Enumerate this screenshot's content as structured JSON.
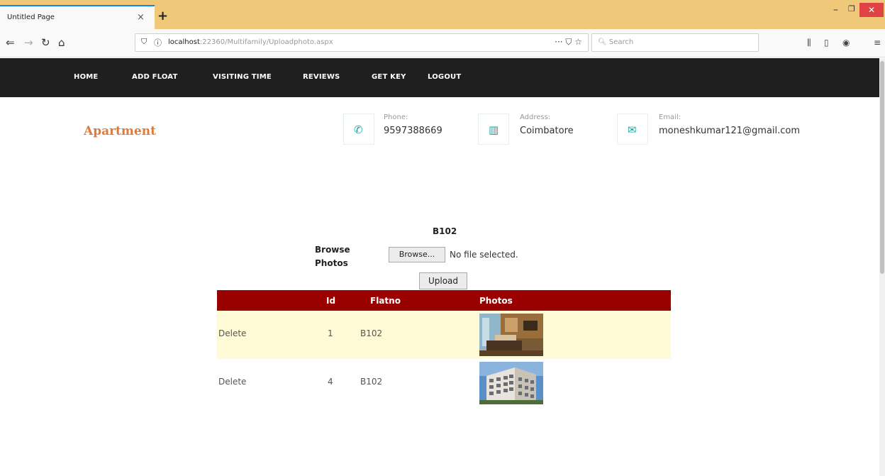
{
  "browser": {
    "tab_title": "Untitled Page",
    "tab_close": "×",
    "new_tab": "+",
    "url_host": "localhost",
    "url_path": ":22360/Multifamily/Uploadphoto.aspx",
    "url_actions": "··· ⛉ ☆",
    "search_placeholder": "Search"
  },
  "site_nav": {
    "items": [
      "HOME",
      "ADD FLOAT",
      "VISITING TIME",
      "REVIEWS",
      "GET KEY",
      "LOGOUT"
    ]
  },
  "header": {
    "brand": "Apartment",
    "phone_label": "Phone:",
    "phone_value": "9597388669",
    "address_label": "Address:",
    "address_value": "Coimbatore",
    "email_label": "Email:",
    "email_value": "moneshkumar121@gmail.com"
  },
  "form": {
    "flat_title": "B102",
    "browse_label": "Browse Photos",
    "browse_button": "Browse...",
    "no_file_text": "No file selected.",
    "upload_button": "Upload"
  },
  "grid": {
    "columns": [
      "",
      "Id",
      "Flatno",
      "Photos"
    ],
    "rows": [
      {
        "action": "Delete",
        "id": "1",
        "flatno": "B102",
        "photo": "interior-photo"
      },
      {
        "action": "Delete",
        "id": "4",
        "flatno": "B102",
        "photo": "building-photo"
      }
    ]
  },
  "colors": {
    "tabbar": "#f0c879",
    "nav_bg": "#1f1f1f",
    "brand": "#e07a3a",
    "accent_teal": "#1aa5a5",
    "grid_header": "#990000",
    "grid_alt_row": "#fffbd6"
  }
}
